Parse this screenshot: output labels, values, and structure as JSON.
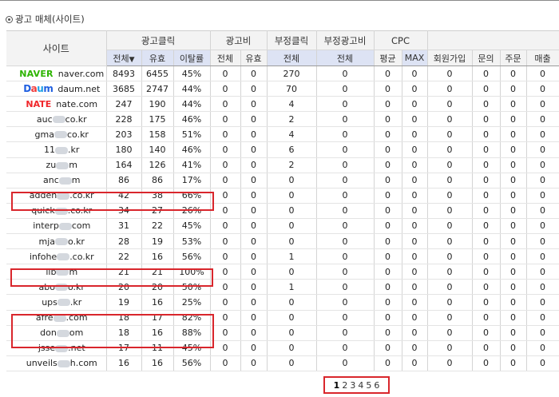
{
  "section_title": "광고 매체(사이트)",
  "header": {
    "site": "사이트",
    "groups": [
      "광고클릭",
      "광고비",
      "부정클릭",
      "부정광고비",
      "CPC",
      "",
      ""
    ],
    "sub": [
      "전체",
      "유효",
      "이탈률",
      "전체",
      "유효",
      "전체",
      "전체",
      "평균",
      "MAX",
      "회원가입",
      "문의",
      "주문",
      "매출"
    ],
    "sort_indicator": "▼"
  },
  "rows": [
    {
      "logo": "NAVER",
      "site": "naver.com",
      "cells": [
        "8493",
        "6455",
        "45%",
        "0",
        "0",
        "270",
        "0",
        "0",
        "0",
        "0",
        "0",
        "0",
        "0"
      ]
    },
    {
      "logo": "Daum",
      "site": "daum.net",
      "cells": [
        "3685",
        "2747",
        "44%",
        "0",
        "0",
        "70",
        "0",
        "0",
        "0",
        "0",
        "0",
        "0",
        "0"
      ]
    },
    {
      "logo": "NATE",
      "site": "nate.com",
      "cells": [
        "247",
        "190",
        "44%",
        "0",
        "0",
        "4",
        "0",
        "0",
        "0",
        "0",
        "0",
        "0",
        "0"
      ]
    },
    {
      "site_pre": "auc",
      "site_post": "co.kr",
      "cells": [
        "228",
        "175",
        "46%",
        "0",
        "0",
        "2",
        "0",
        "0",
        "0",
        "0",
        "0",
        "0",
        "0"
      ]
    },
    {
      "site_pre": "gma",
      "site_post": "co.kr",
      "cells": [
        "203",
        "158",
        "51%",
        "0",
        "0",
        "4",
        "0",
        "0",
        "0",
        "0",
        "0",
        "0",
        "0"
      ]
    },
    {
      "site_pre": "11",
      "site_post": ".kr",
      "cells": [
        "180",
        "140",
        "46%",
        "0",
        "0",
        "6",
        "0",
        "0",
        "0",
        "0",
        "0",
        "0",
        "0"
      ]
    },
    {
      "site_pre": "zu",
      "site_post": "m",
      "cells": [
        "164",
        "126",
        "41%",
        "0",
        "0",
        "2",
        "0",
        "0",
        "0",
        "0",
        "0",
        "0",
        "0"
      ]
    },
    {
      "site_pre": "anc",
      "site_post": "m",
      "cells": [
        "86",
        "86",
        "17%",
        "0",
        "0",
        "0",
        "0",
        "0",
        "0",
        "0",
        "0",
        "0",
        "0"
      ]
    },
    {
      "site_pre": "adden",
      "site_post": ".co.kr",
      "cells": [
        "42",
        "38",
        "66%",
        "0",
        "0",
        "0",
        "0",
        "0",
        "0",
        "0",
        "0",
        "0",
        "0"
      ]
    },
    {
      "site_pre": "quick",
      "site_post": ".co.kr",
      "cells": [
        "34",
        "27",
        "26%",
        "0",
        "0",
        "0",
        "0",
        "0",
        "0",
        "0",
        "0",
        "0",
        "0"
      ]
    },
    {
      "site_pre": "interp",
      "site_post": "com",
      "cells": [
        "31",
        "22",
        "45%",
        "0",
        "0",
        "0",
        "0",
        "0",
        "0",
        "0",
        "0",
        "0",
        "0"
      ]
    },
    {
      "site_pre": "mja",
      "site_post": "o.kr",
      "cells": [
        "28",
        "19",
        "53%",
        "0",
        "0",
        "0",
        "0",
        "0",
        "0",
        "0",
        "0",
        "0",
        "0"
      ]
    },
    {
      "site_pre": "infohe",
      "site_post": ".co.kr",
      "cells": [
        "22",
        "16",
        "56%",
        "0",
        "0",
        "1",
        "0",
        "0",
        "0",
        "0",
        "0",
        "0",
        "0"
      ]
    },
    {
      "site_pre": "ilb",
      "site_post": "m",
      "cells": [
        "21",
        "21",
        "100%",
        "0",
        "0",
        "0",
        "0",
        "0",
        "0",
        "0",
        "0",
        "0",
        "0"
      ]
    },
    {
      "site_pre": "abo",
      "site_post": "o.kr",
      "cells": [
        "20",
        "20",
        "50%",
        "0",
        "0",
        "1",
        "0",
        "0",
        "0",
        "0",
        "0",
        "0",
        "0"
      ]
    },
    {
      "site_pre": "ups",
      "site_post": ".kr",
      "cells": [
        "19",
        "16",
        "25%",
        "0",
        "0",
        "0",
        "0",
        "0",
        "0",
        "0",
        "0",
        "0",
        "0"
      ]
    },
    {
      "site_pre": "afre",
      "site_post": ".com",
      "cells": [
        "18",
        "17",
        "82%",
        "0",
        "0",
        "0",
        "0",
        "0",
        "0",
        "0",
        "0",
        "0",
        "0"
      ]
    },
    {
      "site_pre": "don",
      "site_post": "om",
      "cells": [
        "18",
        "16",
        "88%",
        "0",
        "0",
        "0",
        "0",
        "0",
        "0",
        "0",
        "0",
        "0",
        "0"
      ]
    },
    {
      "site_pre": "jsse",
      "site_post": ".net",
      "cells": [
        "17",
        "11",
        "45%",
        "0",
        "0",
        "0",
        "0",
        "0",
        "0",
        "0",
        "0",
        "0",
        "0"
      ]
    },
    {
      "site_pre": "unveils",
      "site_post": "h.com",
      "cells": [
        "16",
        "16",
        "56%",
        "0",
        "0",
        "0",
        "0",
        "0",
        "0",
        "0",
        "0",
        "0",
        "0"
      ]
    }
  ],
  "pagination": {
    "pages": [
      "1",
      "2",
      "3",
      "4",
      "5",
      "6"
    ],
    "current": "1"
  },
  "colors": {
    "highlight_border": "#d9262c",
    "naver_green": "#2db400",
    "nate_red": "#f0262a"
  }
}
